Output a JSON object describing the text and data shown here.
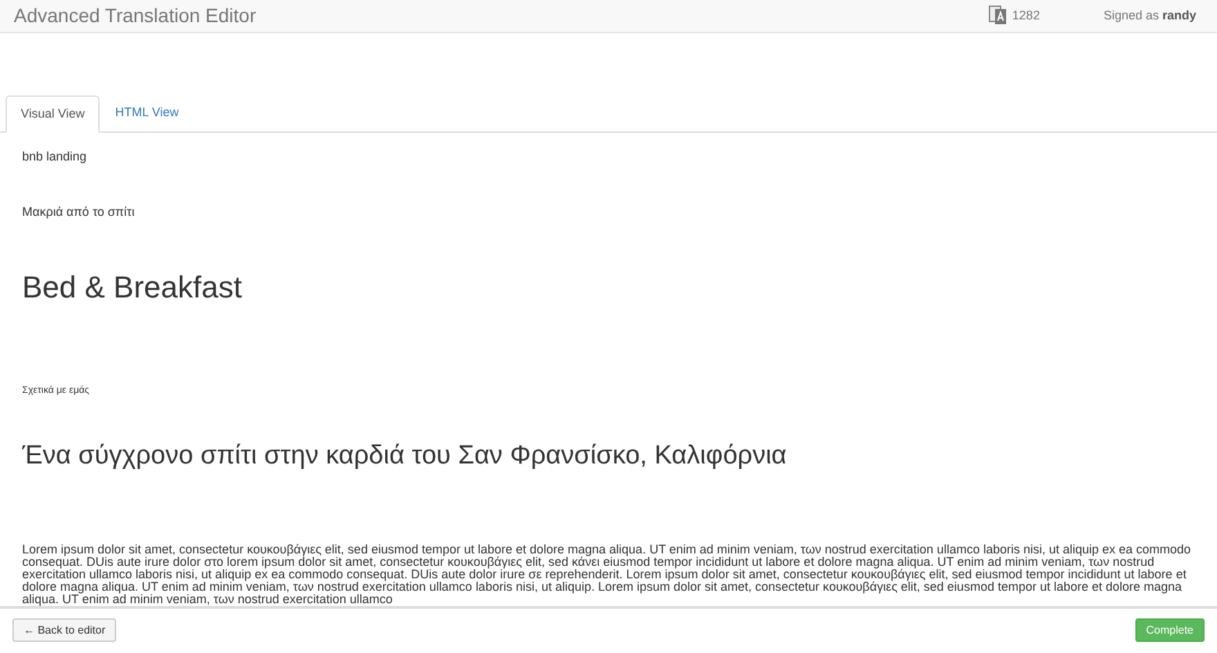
{
  "header": {
    "title": "Advanced Translation Editor",
    "count": "1282",
    "signed_in_label": "Signed as",
    "user": "randy"
  },
  "tabs": [
    {
      "label": "Visual View",
      "selected": true
    },
    {
      "label": "HTML View",
      "selected": false
    }
  ],
  "content": [
    {
      "kind": "text",
      "text": "bnb landing"
    },
    {
      "kind": "text",
      "text": "Μακριά από το σπίτι"
    },
    {
      "kind": "h1",
      "text": "Bed & Breakfast"
    },
    {
      "kind": "small",
      "text": "Σχετικά με εμάς"
    },
    {
      "kind": "h2",
      "text": "Ένα σύγχρονο σπίτι στην καρδιά του Σαν Φρανσίσκο, Καλιφόρνια"
    },
    {
      "kind": "paragraph",
      "text": "Lorem ipsum dolor sit amet, consectetur κουκουβάγιες elit, sed eiusmod tempor ut labore et dolore magna aliqua. UT enim ad minim veniam, των nostrud exercitation ullamco laboris nisi, ut aliquip ex ea commodo consequat. DUis aute irure dolor στο lorem ipsum dolor sit amet, consectetur κουκουβάγιες elit, sed κάνει eiusmod tempor incididunt ut labore et dolore magna aliqua. UT enim ad minim veniam, των nostrud exercitation ullamco laboris nisi, ut aliquip ex ea commodo consequat. DUis aute dolor irure σε reprehenderit. Lorem ipsum dolor sit amet, consectetur κουκουβάγιες elit, sed eiusmod tempor incididunt ut labore et dolore magna aliqua. UT enim ad minim veniam, των nostrud exercitation ullamco laboris nisi, ut aliquip. Lorem ipsum dolor sit amet, consectetur κουκουβάγιες elit, sed eiusmod tempor ut labore et dolore magna aliqua. UT enim ad minim veniam, των nostrud exercitation ullamco"
    }
  ],
  "footer": {
    "back_button": "← Back to editor",
    "complete_button": "Complete"
  }
}
